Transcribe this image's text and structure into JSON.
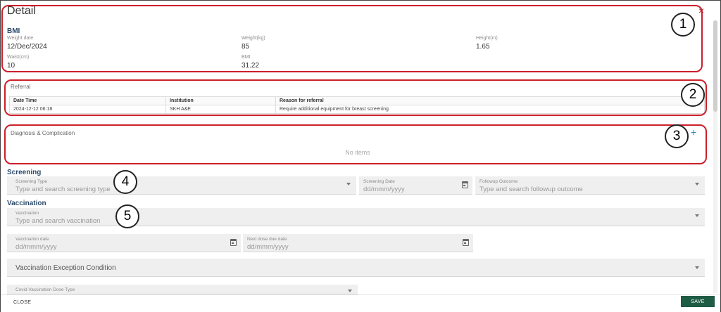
{
  "dialog": {
    "title": "Detail",
    "close_icon": "×"
  },
  "bmi": {
    "heading": "BMI",
    "fields": [
      {
        "label": "Weight date",
        "value": "12/Dec/2024"
      },
      {
        "label": "Weight(kg)",
        "value": "85"
      },
      {
        "label": "Height(m)",
        "value": "1.65"
      },
      {
        "label": "Waist(cm)",
        "value": "10"
      },
      {
        "label": "BMI",
        "value": "31.22"
      }
    ]
  },
  "referral": {
    "heading": "Referral",
    "columns": [
      "Date Time",
      "Institution",
      "Reason for referral"
    ],
    "rows": [
      [
        "2024-12-12 06:18",
        "SKH A&E",
        "Require additional equipment for breast screening"
      ]
    ]
  },
  "diagnosis": {
    "heading": "Diagnosis & Complication",
    "empty_text": "No items",
    "add_icon": "+"
  },
  "screening": {
    "heading": "Screening",
    "type_label": "Screening Type",
    "type_placeholder": "Type and search screening type",
    "date_label": "Screening Date",
    "date_placeholder": "dd/mmm/yyyy",
    "outcome_label": "Followup Outcome",
    "outcome_placeholder": "Type and search followup outcome"
  },
  "vaccination": {
    "heading": "Vaccination",
    "vaccination_label": "Vaccination",
    "vaccination_placeholder": "Type and search vaccination",
    "date_label": "Vaccination date",
    "date_placeholder": "dd/mmm/yyyy",
    "next_label": "Next dose due date",
    "next_placeholder": "dd/mmm/yyyy",
    "exception_label": "Vaccination Exception Condition",
    "covid_label": "Covid Vaccination Dose Type"
  },
  "footer": {
    "close_label": "CLOSE",
    "save_label": "SAVE"
  },
  "annotations": [
    "1",
    "2",
    "3",
    "4",
    "5"
  ],
  "colors": {
    "annotation": "#cc1f2b",
    "save": "#1f5c45",
    "heading": "#2c4a6b",
    "close_icon": "#b0131b",
    "add_icon": "#2b88b8"
  },
  "icons": {
    "close": "close-icon",
    "add": "plus-icon",
    "calendar": "calendar-icon",
    "dropdown": "chevron-down-icon"
  }
}
